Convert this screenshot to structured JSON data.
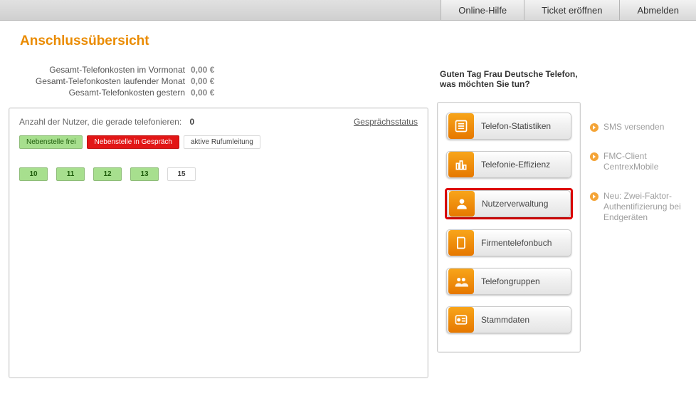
{
  "topnav": {
    "help": "Online-Hilfe",
    "ticket": "Ticket eröffnen",
    "logout": "Abmelden"
  },
  "page_title": "Anschlussübersicht",
  "costs": [
    {
      "label": "Gesamt-Telefonkosten im Vormonat",
      "value": "0,00 €"
    },
    {
      "label": "Gesamt-Telefonkosten laufender Monat",
      "value": "0,00 €"
    },
    {
      "label": "Gesamt-Telefonkosten gestern",
      "value": "0,00 €"
    }
  ],
  "panel": {
    "count_label": "Anzahl der Nutzer, die gerade telefonieren:",
    "count_value": "0",
    "status_link": "Gesprächsstatus",
    "legend": {
      "free": "Nebenstelle frei",
      "busy": "Nebenstelle in Gespräch",
      "fwd": "aktive Rufumleitung"
    },
    "extensions": [
      {
        "num": "10",
        "state": "free"
      },
      {
        "num": "11",
        "state": "free"
      },
      {
        "num": "12",
        "state": "free"
      },
      {
        "num": "13",
        "state": "free"
      },
      {
        "num": "15",
        "state": "fwd"
      }
    ]
  },
  "greeting": {
    "line1": "Guten Tag Frau Deutsche Telefon,",
    "line2": "was möchten Sie tun?"
  },
  "menu": [
    {
      "id": "stats",
      "label": "Telefon-Statistiken",
      "highlighted": false
    },
    {
      "id": "eff",
      "label": "Telefonie-Effizienz",
      "highlighted": false
    },
    {
      "id": "users",
      "label": "Nutzerverwaltung",
      "highlighted": true
    },
    {
      "id": "book",
      "label": "Firmentelefonbuch",
      "highlighted": false
    },
    {
      "id": "groups",
      "label": "Telefongruppen",
      "highlighted": false
    },
    {
      "id": "master",
      "label": "Stammdaten",
      "highlighted": false
    }
  ],
  "tips": [
    "SMS versenden",
    "FMC-Client CentrexMobile",
    "Neu: Zwei-Faktor-Authentifizierung bei Endgeräten"
  ]
}
